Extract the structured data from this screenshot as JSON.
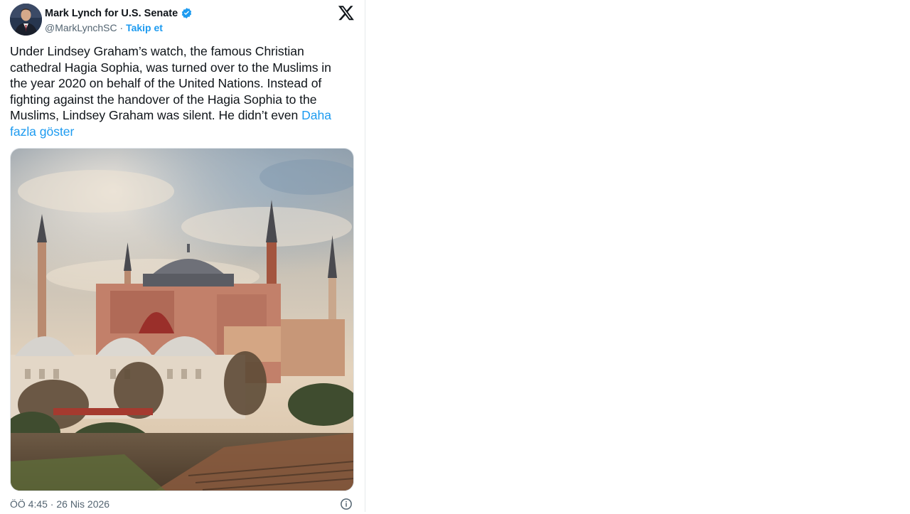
{
  "tweet": {
    "author": {
      "display_name": "Mark Lynch for U.S. Senate",
      "handle": "@MarkLynchSC",
      "separator": " · ",
      "follow_label": "Takip et",
      "verified_icon": "verified-badge-icon",
      "avatar_icon": "avatar"
    },
    "brand_icon": "x-logo-icon",
    "text": "Under Lindsey Graham’s watch, the famous Christian cathedral Hagia Sophia, was turned over to the Muslims in the year 2020 on behalf of the United Nations. Instead of fighting against the handover of the Hagia Sophia to the Muslims, Lindsey Graham was silent. He didn’t even ",
    "show_more_label": "Daha fazla göster",
    "media": {
      "type": "photo",
      "subject": "hagia-sophia-photo"
    },
    "timestamp": "ÖÖ 4:45 · 26 Nis 2026",
    "info_icon": "info-icon"
  },
  "colors": {
    "link": "#1d9bf0",
    "verified": "#1d9bf0",
    "text_primary": "#0f1419",
    "text_secondary": "#536471"
  }
}
